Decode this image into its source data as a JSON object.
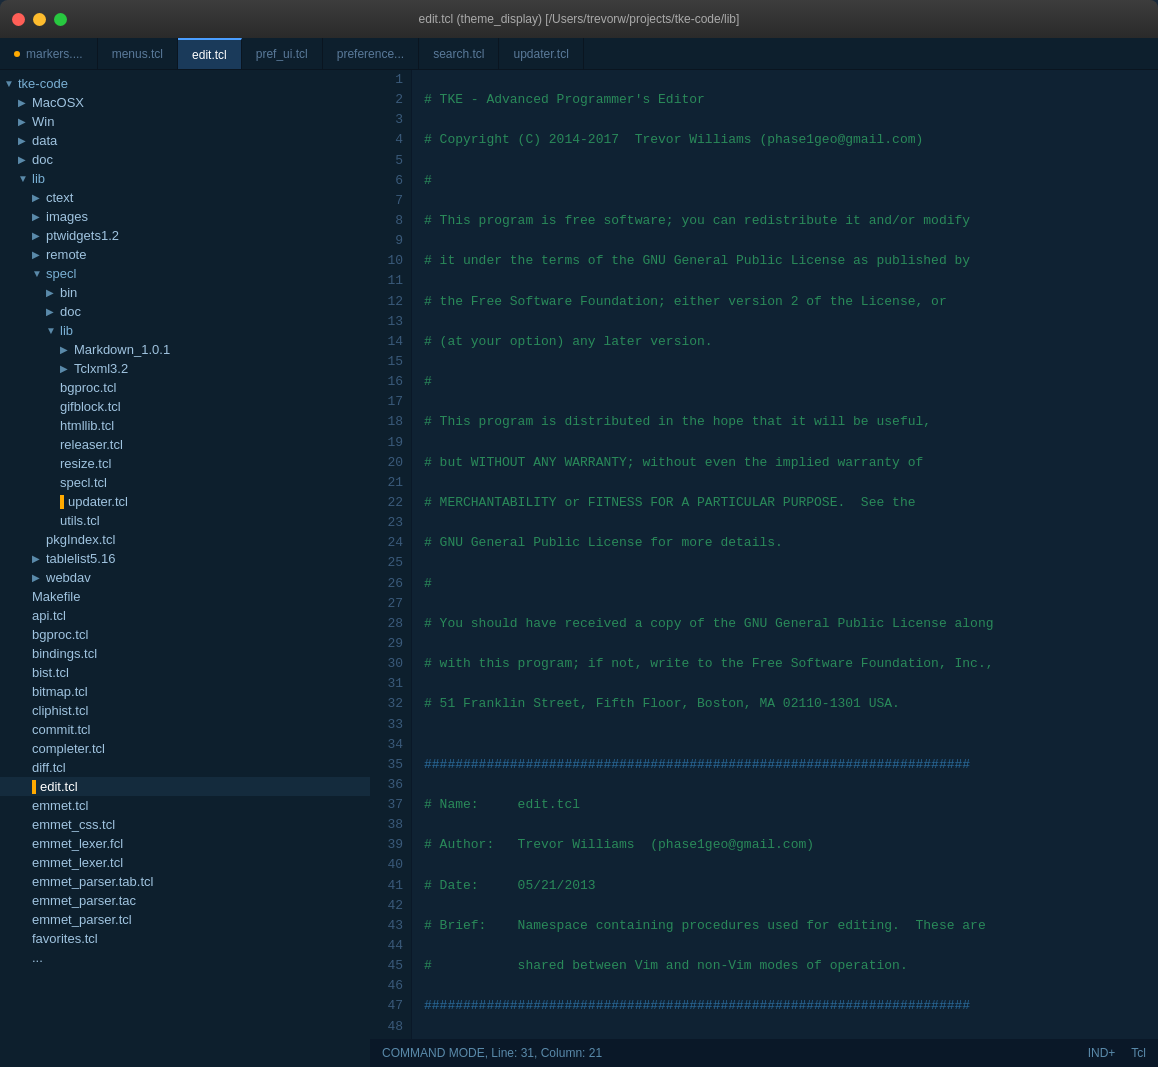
{
  "titlebar": {
    "title": "edit.tcl (theme_display) [/Users/trevorw/projects/tke-code/lib]"
  },
  "tabs": [
    {
      "id": "markers",
      "label": "markers....",
      "active": false,
      "modified": true
    },
    {
      "id": "menus",
      "label": "menus.tcl",
      "active": false,
      "modified": false
    },
    {
      "id": "edit",
      "label": "edit.tcl",
      "active": true,
      "modified": false
    },
    {
      "id": "pref_ui",
      "label": "pref_ui.tcl",
      "active": false,
      "modified": false
    },
    {
      "id": "preference",
      "label": "preference...",
      "active": false,
      "modified": false
    },
    {
      "id": "search",
      "label": "search.tcl",
      "active": false,
      "modified": false
    },
    {
      "id": "updater",
      "label": "updater.tcl",
      "active": false,
      "modified": false
    }
  ],
  "sidebar": {
    "root": "tke-code",
    "items": [
      {
        "level": 1,
        "type": "folder",
        "name": "MacOSX",
        "expanded": false
      },
      {
        "level": 1,
        "type": "folder",
        "name": "Win",
        "expanded": false
      },
      {
        "level": 1,
        "type": "folder",
        "name": "data",
        "expanded": false
      },
      {
        "level": 1,
        "type": "folder",
        "name": "doc",
        "expanded": false
      },
      {
        "level": 1,
        "type": "folder",
        "name": "lib",
        "expanded": true
      },
      {
        "level": 2,
        "type": "folder",
        "name": "ctext",
        "expanded": false
      },
      {
        "level": 2,
        "type": "folder",
        "name": "images",
        "expanded": false
      },
      {
        "level": 2,
        "type": "folder",
        "name": "ptwidgets1.2",
        "expanded": false
      },
      {
        "level": 2,
        "type": "folder",
        "name": "remote",
        "expanded": false
      },
      {
        "level": 2,
        "type": "folder",
        "name": "specl",
        "expanded": true
      },
      {
        "level": 3,
        "type": "folder",
        "name": "bin",
        "expanded": false
      },
      {
        "level": 3,
        "type": "folder",
        "name": "doc",
        "expanded": false
      },
      {
        "level": 3,
        "type": "folder",
        "name": "lib",
        "expanded": true
      },
      {
        "level": 4,
        "type": "folder",
        "name": "Markdown_1.0.1",
        "expanded": false
      },
      {
        "level": 4,
        "type": "folder",
        "name": "Tclxml3.2",
        "expanded": false
      },
      {
        "level": 3,
        "type": "file",
        "name": "bgproc.tcl"
      },
      {
        "level": 3,
        "type": "file",
        "name": "gifblock.tcl"
      },
      {
        "level": 3,
        "type": "file",
        "name": "htmllib.tcl"
      },
      {
        "level": 3,
        "type": "file",
        "name": "releaser.tcl"
      },
      {
        "level": 3,
        "type": "file",
        "name": "resize.tcl"
      },
      {
        "level": 3,
        "type": "file",
        "name": "specl.tcl"
      },
      {
        "level": 3,
        "type": "file",
        "name": "updater.tcl",
        "marked": true
      },
      {
        "level": 3,
        "type": "file",
        "name": "utils.tcl"
      },
      {
        "level": 2,
        "type": "file",
        "name": "pkgIndex.tcl"
      },
      {
        "level": 2,
        "type": "folder",
        "name": "tablelist5.16",
        "expanded": false
      },
      {
        "level": 2,
        "type": "folder",
        "name": "webdav",
        "expanded": false
      },
      {
        "level": 1,
        "type": "file",
        "name": "Makefile"
      },
      {
        "level": 1,
        "type": "file",
        "name": "api.tcl"
      },
      {
        "level": 1,
        "type": "file",
        "name": "bgproc.tcl"
      },
      {
        "level": 1,
        "type": "file",
        "name": "bindings.tcl"
      },
      {
        "level": 1,
        "type": "file",
        "name": "bist.tcl"
      },
      {
        "level": 1,
        "type": "file",
        "name": "bitmap.tcl"
      },
      {
        "level": 1,
        "type": "file",
        "name": "cliphist.tcl"
      },
      {
        "level": 1,
        "type": "file",
        "name": "commit.tcl"
      },
      {
        "level": 1,
        "type": "file",
        "name": "completer.tcl"
      },
      {
        "level": 1,
        "type": "file",
        "name": "diff.tcl"
      },
      {
        "level": 1,
        "type": "file",
        "name": "edit.tcl",
        "marked": true,
        "active": true
      },
      {
        "level": 1,
        "type": "file",
        "name": "emmet.tcl"
      },
      {
        "level": 1,
        "type": "file",
        "name": "emmet_css.tcl"
      },
      {
        "level": 1,
        "type": "file",
        "name": "emmet_lexer.fcl"
      },
      {
        "level": 1,
        "type": "file",
        "name": "emmet_lexer.tcl"
      },
      {
        "level": 1,
        "type": "file",
        "name": "emmet_parser.tab.tcl"
      },
      {
        "level": 1,
        "type": "file",
        "name": "emmet_parser.tac"
      },
      {
        "level": 1,
        "type": "file",
        "name": "emmet_parser.tcl"
      },
      {
        "level": 1,
        "type": "file",
        "name": "favorites.tcl"
      },
      {
        "level": 1,
        "type": "file",
        "name": "..."
      }
    ]
  },
  "status_bar": {
    "left": "COMMAND MODE, Line: 31, Column: 21",
    "right_indent": "IND+",
    "right_lang": "Tcl"
  }
}
